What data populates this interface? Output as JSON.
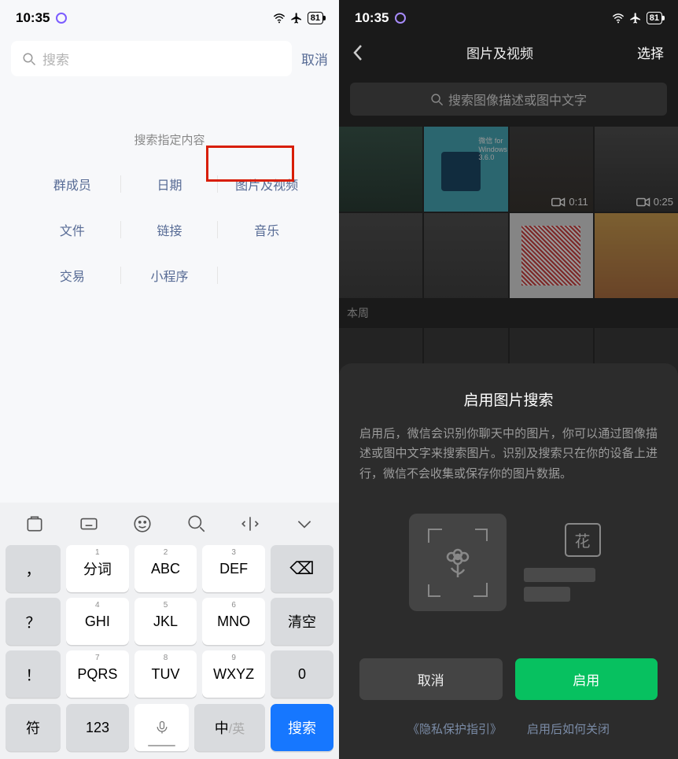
{
  "status": {
    "time": "10:35",
    "battery": "81"
  },
  "left": {
    "search_placeholder": "搜索",
    "cancel": "取消",
    "heading": "搜索指定内容",
    "categories": [
      "群成员",
      "日期",
      "图片及视频",
      "文件",
      "链接",
      "音乐",
      "交易",
      "小程序"
    ]
  },
  "keyboard": {
    "keys": [
      {
        "sup": "1",
        "main": "分词"
      },
      {
        "sup": "2",
        "main": "ABC"
      },
      {
        "sup": "3",
        "main": "DEF"
      },
      {
        "sup": "4",
        "main": "GHI"
      },
      {
        "sup": "5",
        "main": "JKL"
      },
      {
        "sup": "6",
        "main": "MNO"
      },
      {
        "sup": "7",
        "main": "PQRS"
      },
      {
        "sup": "8",
        "main": "TUV"
      },
      {
        "sup": "9",
        "main": "WXYZ"
      }
    ],
    "sides_left": [
      "，",
      "？",
      "！"
    ],
    "sides_right": {
      "backspace": "⌫",
      "clear": "清空",
      "zero": "0"
    },
    "bottom": {
      "sym": "符",
      "num": "123",
      "lang_zh": "中",
      "lang_en": "/英",
      "search": "搜索"
    }
  },
  "right": {
    "nav_title": "图片及视频",
    "nav_select": "选择",
    "search_placeholder": "搜索图像描述或图中文字",
    "section_label": "本周",
    "videos": [
      {
        "duration": "0:11"
      },
      {
        "duration": "0:25"
      }
    ],
    "thumb_text": "微信 for Windows 3.6.0",
    "modal": {
      "title": "启用图片搜索",
      "desc": "启用后，微信会识别你聊天中的图片，你可以通过图像描述或图中文字来搜索图片。识别及搜索只在你的设备上进行，微信不会收集或保存你的图片数据。",
      "illus_char": "花",
      "cancel": "取消",
      "enable": "启用",
      "link_privacy": "《隐私保护指引》",
      "link_howto": "启用后如何关闭"
    }
  }
}
